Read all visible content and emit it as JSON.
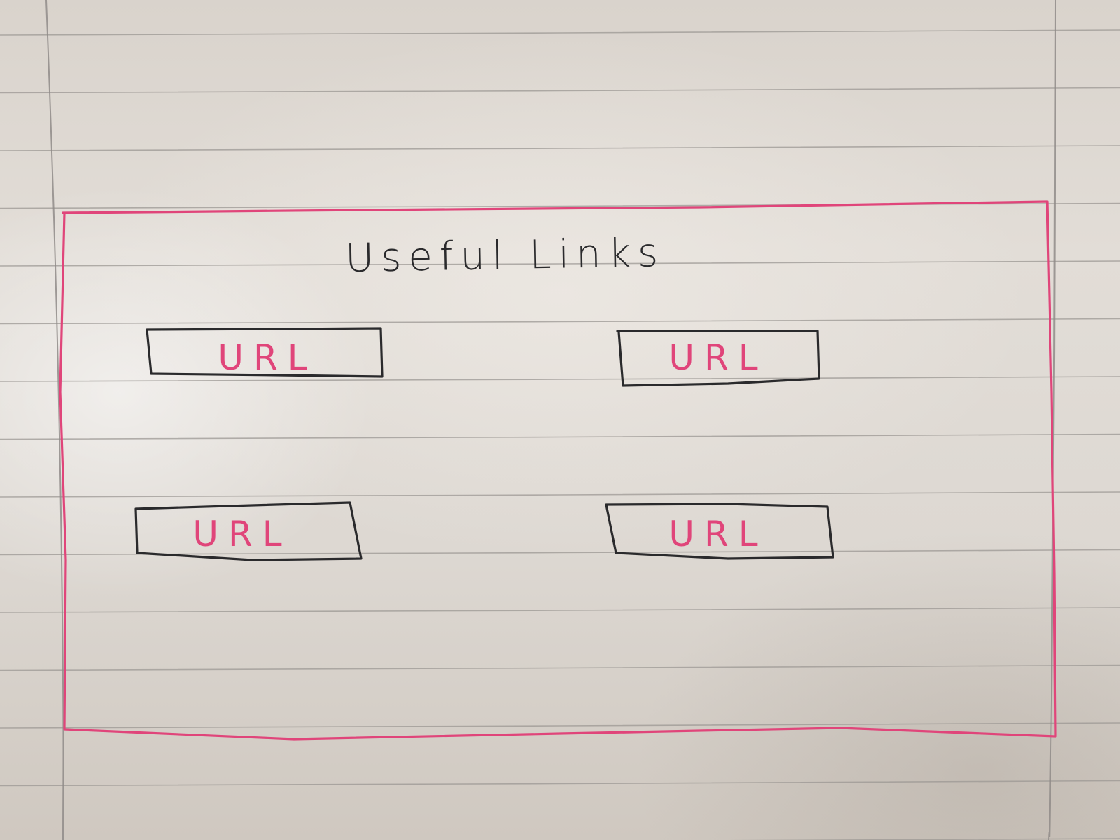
{
  "title": "Useful Links",
  "links": [
    {
      "label": "URL"
    },
    {
      "label": "URL"
    },
    {
      "label": "URL"
    },
    {
      "label": "URL"
    }
  ],
  "colors": {
    "paper": "#e2ddd7",
    "rule_line": "#9c9894",
    "margin_line": "#8f8b88",
    "pink_ink": "#e0457a",
    "black_ink": "#2a2a2c"
  }
}
